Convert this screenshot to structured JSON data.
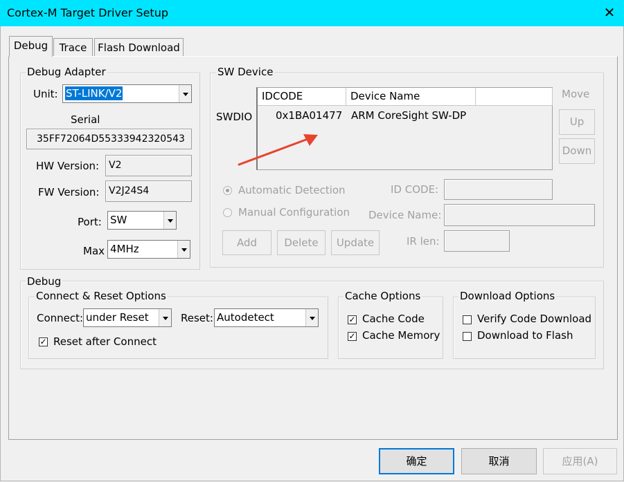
{
  "window": {
    "title": "Cortex-M Target Driver Setup",
    "close_glyph": "✕"
  },
  "tabs": [
    "Debug",
    "Trace",
    "Flash Download"
  ],
  "debug_adapter": {
    "legend": "Debug Adapter",
    "unit_label": "Unit:",
    "unit_value": "ST-LINK/V2",
    "serial_label": "Serial",
    "serial_value": "35FF72064D55333942320543",
    "hw_label": "HW Version:",
    "hw_value": "V2",
    "fw_label": "FW Version:",
    "fw_value": "V2J24S4",
    "port_label": "Port:",
    "port_value": "SW",
    "max_label": "Max",
    "max_value": "4MHz"
  },
  "sw_device": {
    "legend": "SW Device",
    "columns": [
      "IDCODE",
      "Device Name"
    ],
    "row_label": "SWDIO",
    "rows": [
      {
        "idcode": "0x1BA01477",
        "device_name": "ARM CoreSight SW-DP"
      }
    ],
    "move_label": "Move",
    "up_label": "Up",
    "down_label": "Down",
    "auto_detect_label": "Automatic Detection",
    "manual_config_label": "Manual Configuration",
    "id_code_label": "ID CODE:",
    "device_name_label": "Device Name:",
    "ir_len_label": "IR len:",
    "add_label": "Add",
    "delete_label": "Delete",
    "update_label": "Update"
  },
  "debug": {
    "legend": "Debug",
    "connect_reset": {
      "legend": "Connect & Reset Options",
      "connect_label": "Connect:",
      "connect_value": "under Reset",
      "reset_label": "Reset:",
      "reset_value": "Autodetect",
      "reset_after_connect": "Reset after Connect",
      "reset_after_connect_checked": true
    },
    "cache": {
      "legend": "Cache Options",
      "cache_code": "Cache Code",
      "cache_code_checked": true,
      "cache_memory": "Cache Memory",
      "cache_memory_checked": true
    },
    "download": {
      "legend": "Download Options",
      "verify": "Verify Code Download",
      "verify_checked": false,
      "download_to_flash": "Download to Flash",
      "download_to_flash_checked": false
    }
  },
  "footer": {
    "ok": "确定",
    "cancel": "取消",
    "apply": "应用(A)"
  },
  "colors": {
    "titlebar": "#00e5ff",
    "selection": "#0078d7",
    "arrow": "#e8432d"
  },
  "checkmark_glyph": "✓"
}
